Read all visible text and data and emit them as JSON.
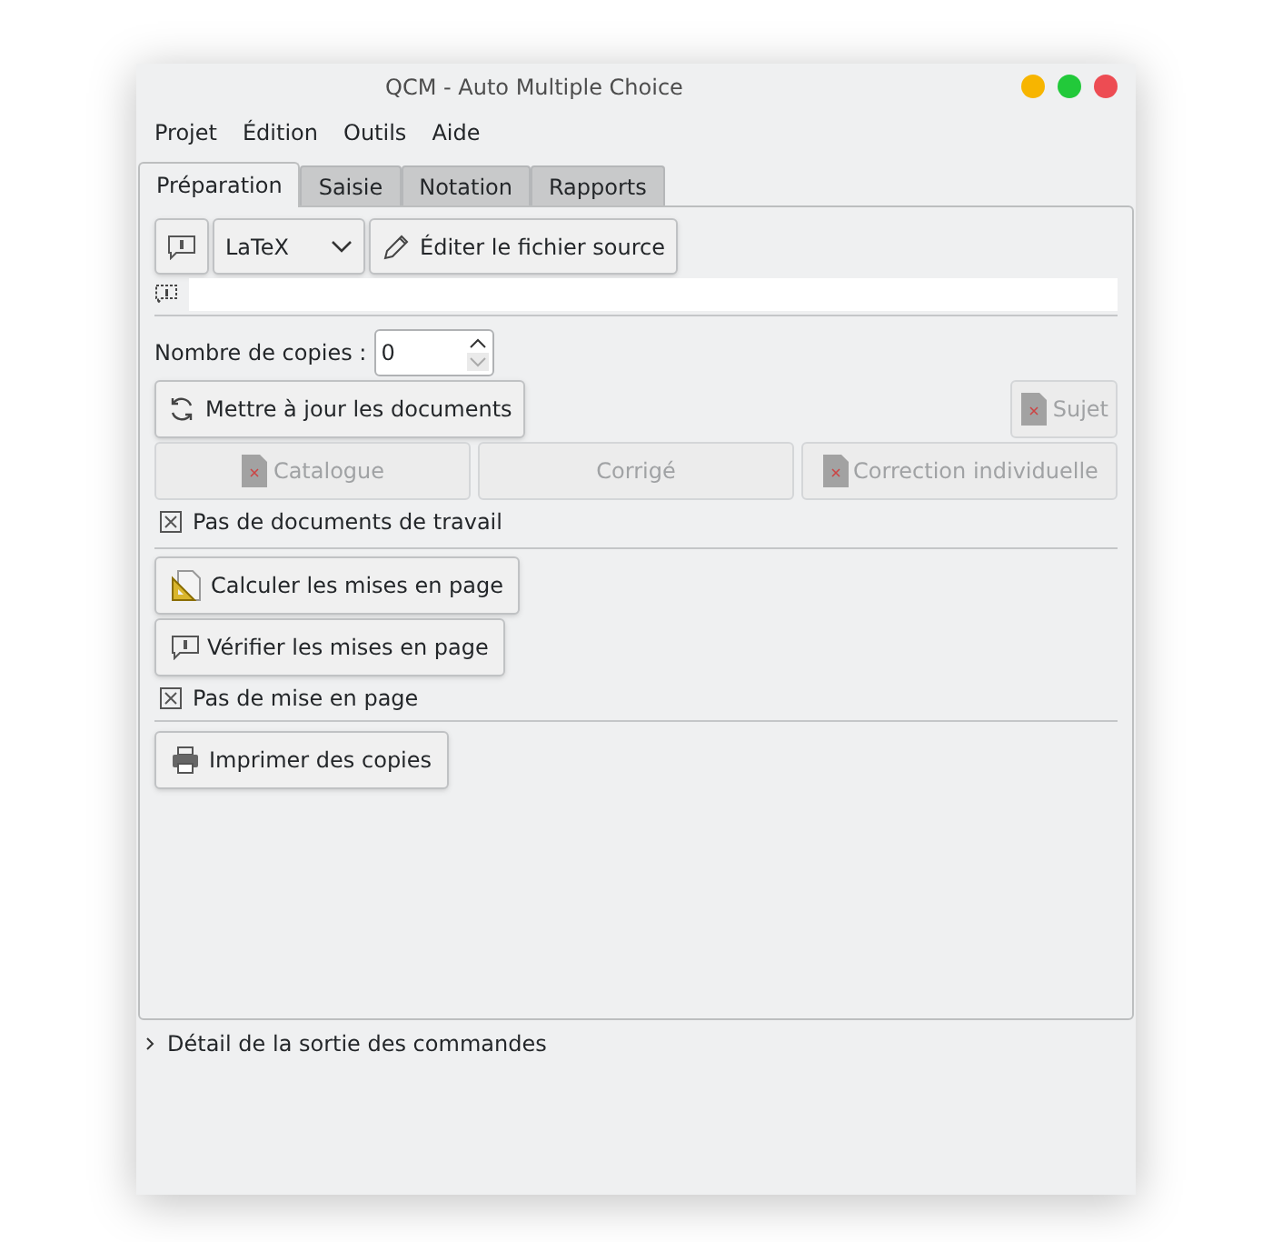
{
  "window": {
    "title": "QCM - Auto Multiple Choice"
  },
  "menu": [
    "Projet",
    "Édition",
    "Outils",
    "Aide"
  ],
  "tabs": [
    {
      "label": "Préparation",
      "selected": true
    },
    {
      "label": "Saisie",
      "selected": false
    },
    {
      "label": "Notation",
      "selected": false
    },
    {
      "label": "Rapports",
      "selected": false
    }
  ],
  "source": {
    "format": "LaTeX",
    "edit_button": "Éditer le fichier source"
  },
  "copies": {
    "label": "Nombre de copies :",
    "value": "0"
  },
  "update_button": "Mettre à jour les documents",
  "documents": [
    {
      "label": "Sujet",
      "disabled": true,
      "has_icon": true
    },
    {
      "label": "Catalogue",
      "disabled": true,
      "has_icon": true
    },
    {
      "label": "Corrigé",
      "disabled": true,
      "has_icon": false
    },
    {
      "label": "Correction individuelle",
      "disabled": true,
      "has_icon": true
    }
  ],
  "documents_status": "Pas de documents de travail",
  "layout_buttons": [
    {
      "label": "Calculer les mises en page",
      "kind": "calculate"
    },
    {
      "label": "Vérifier les mises en page",
      "kind": "check"
    }
  ],
  "layout_status": "Pas de mise en page",
  "print_button": "Imprimer des copies",
  "output_expander": {
    "label": "Détail de la sortie des commandes",
    "expanded": false
  }
}
